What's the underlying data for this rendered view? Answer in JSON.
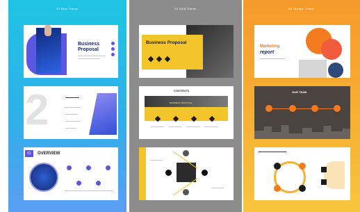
{
  "columns": [
    {
      "label": "01 Blue Theme",
      "accent": "#1fc4e3",
      "slides": {
        "cover_title_line1": "Business",
        "cover_title_line2": "Proposal",
        "agenda_number": "2",
        "overview_number": "01",
        "overview_title": "OVERVIEW"
      }
    },
    {
      "label": "02 Gold Theme",
      "accent": "#f3c52b",
      "slides": {
        "cover_title": "Business Proposal",
        "section_title": "CONTENTS",
        "banner_text": "BUSINESS PROPOSAL"
      }
    },
    {
      "label": "03 Orange Theme",
      "accent": "#f47b20",
      "slides": {
        "cover_title_line1": "Marketing",
        "cover_title_line2": "report",
        "stats_title": "OUR TEAM"
      }
    }
  ],
  "icons": [
    "hand-icon",
    "chart-icon",
    "user-icon",
    "node-icon"
  ]
}
